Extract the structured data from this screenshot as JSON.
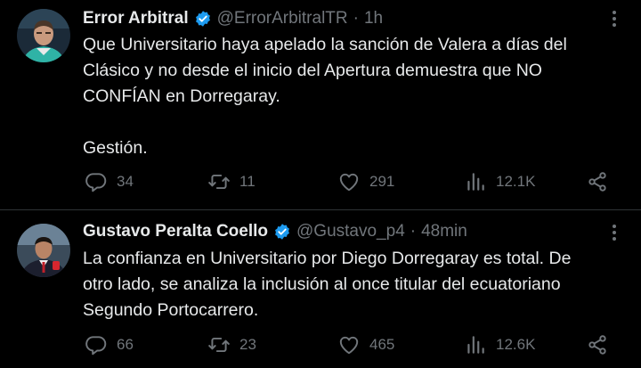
{
  "colors": {
    "background": "#000000",
    "text_primary": "#e7e9ea",
    "text_secondary": "#71767b",
    "divider": "#2f3336",
    "verified_badge": "#1d9bf0"
  },
  "tweets": [
    {
      "display_name": "Error Arbitral",
      "verified": true,
      "handle": "@ErrorArbitralTR",
      "separator": "·",
      "time": "1h",
      "text_lines": [
        "Que Universitario haya apelado la sanción de Valera a días del",
        "Clásico y no desde el inicio del Apertura demuestra que NO",
        "CONFÍAN en Dorregaray.",
        "",
        "Gestión."
      ],
      "actions": {
        "replies": "34",
        "retweets": "11",
        "likes": "291",
        "views": "12.1K"
      },
      "icons": [
        "reply-icon",
        "retweet-icon",
        "like-icon",
        "views-icon",
        "share-icon",
        "more-icon",
        "verified-icon"
      ]
    },
    {
      "display_name": "Gustavo Peralta Coello",
      "verified": true,
      "handle": "@Gustavo_p4",
      "separator": "·",
      "time": "48min",
      "text_lines": [
        "La confianza en Universitario por Diego Dorregaray es total. De",
        "otro lado, se analiza la inclusión al once titular del ecuatoriano",
        "Segundo Portocarrero."
      ],
      "actions": {
        "replies": "66",
        "retweets": "23",
        "likes": "465",
        "views": "12.6K"
      },
      "icons": [
        "reply-icon",
        "retweet-icon",
        "like-icon",
        "views-icon",
        "share-icon",
        "more-icon",
        "verified-icon"
      ]
    }
  ]
}
